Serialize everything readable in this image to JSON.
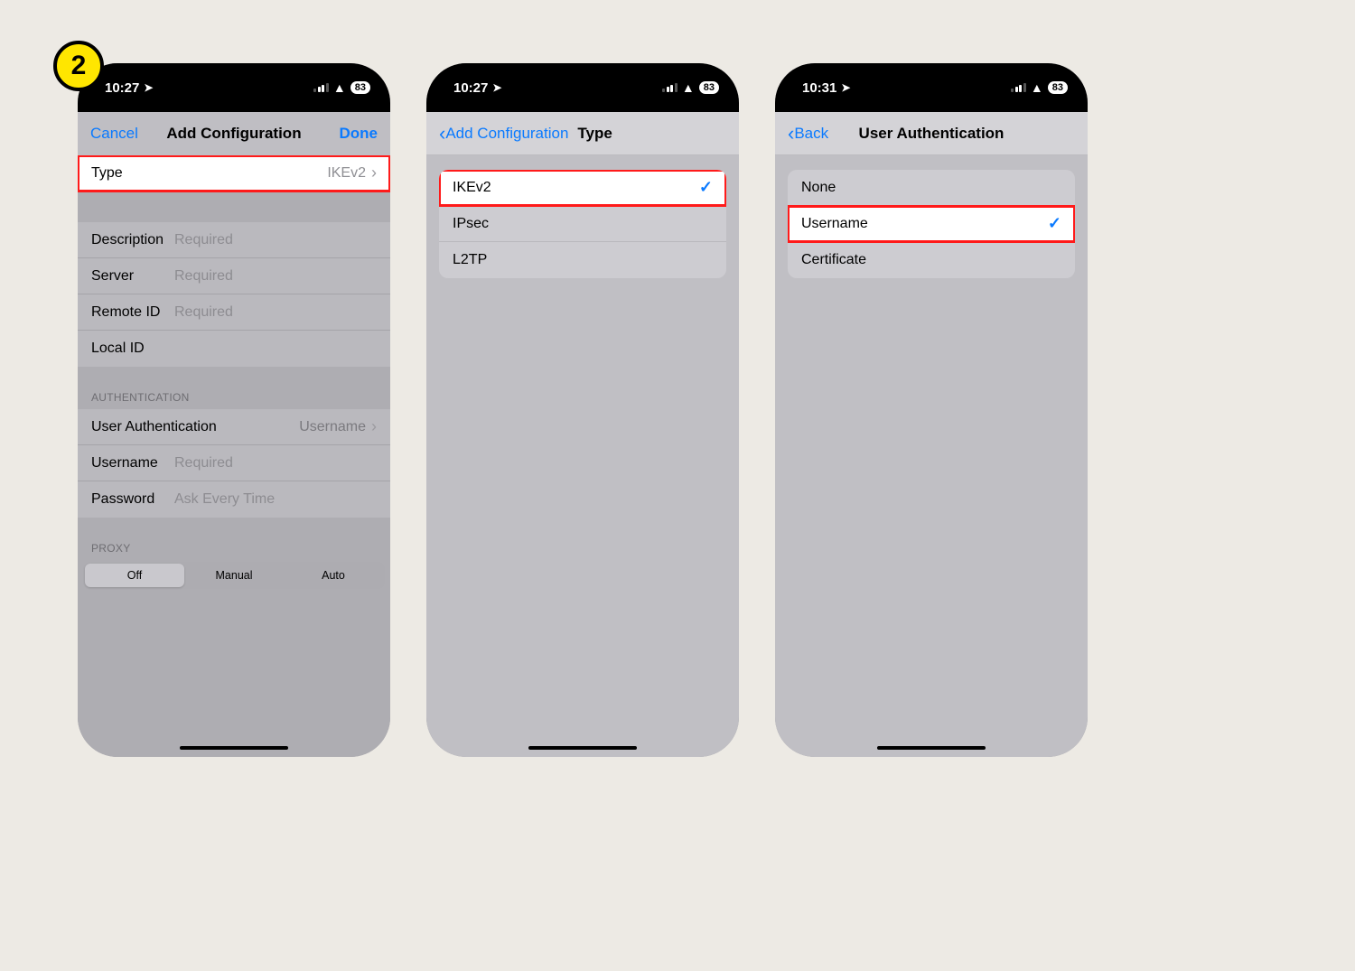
{
  "badge": "2",
  "statusbar": {
    "time_a": "10:27",
    "time_b": "10:31",
    "battery": "83"
  },
  "screen1": {
    "nav": {
      "cancel": "Cancel",
      "title": "Add Configuration",
      "done": "Done"
    },
    "type_row": {
      "label": "Type",
      "value": "IKEv2"
    },
    "fields": {
      "description": {
        "label": "Description",
        "placeholder": "Required"
      },
      "server": {
        "label": "Server",
        "placeholder": "Required"
      },
      "remote_id": {
        "label": "Remote ID",
        "placeholder": "Required"
      },
      "local_id": {
        "label": "Local ID",
        "placeholder": ""
      }
    },
    "auth_header": "AUTHENTICATION",
    "auth": {
      "user_auth": {
        "label": "User Authentication",
        "value": "Username"
      },
      "username": {
        "label": "Username",
        "placeholder": "Required"
      },
      "password": {
        "label": "Password",
        "placeholder": "Ask Every Time"
      }
    },
    "proxy_header": "PROXY",
    "proxy": {
      "off": "Off",
      "manual": "Manual",
      "auto": "Auto"
    }
  },
  "screen2": {
    "nav": {
      "back": "Add Configuration",
      "title": "Type"
    },
    "options": [
      {
        "label": "IKEv2",
        "selected": true
      },
      {
        "label": "IPsec",
        "selected": false
      },
      {
        "label": "L2TP",
        "selected": false
      }
    ]
  },
  "screen3": {
    "nav": {
      "back": "Back",
      "title": "User Authentication"
    },
    "options": [
      {
        "label": "None",
        "selected": false
      },
      {
        "label": "Username",
        "selected": true
      },
      {
        "label": "Certificate",
        "selected": false
      }
    ]
  }
}
